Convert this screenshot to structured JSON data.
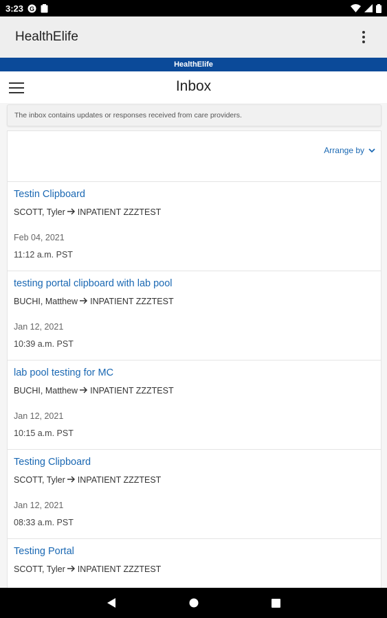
{
  "status_bar": {
    "time": "3:23",
    "icons": [
      "google-icon",
      "clipboard-icon",
      "wifi-icon",
      "signal-icon",
      "battery-icon"
    ]
  },
  "app_bar": {
    "title": "HealthElife",
    "overflow_icon": "more-vert-icon"
  },
  "brand_strip": {
    "label": "HealthElife",
    "color": "#0b4a99"
  },
  "page": {
    "title": "Inbox",
    "menu_icon": "hamburger-icon",
    "info_text": "The inbox contains updates or responses received from care providers."
  },
  "arrange": {
    "label": "Arrange by",
    "icon": "chevron-down-icon"
  },
  "messages": [
    {
      "title": "Testin Clipboard",
      "from": "SCOTT, Tyler",
      "to": "INPATIENT ZZZTEST",
      "date": "Feb 04, 2021",
      "time": "11:12 a.m. PST"
    },
    {
      "title": "testing portal clipboard with lab pool",
      "from": "BUCHI, Matthew",
      "to": "INPATIENT ZZZTEST",
      "date": "Jan 12, 2021",
      "time": "10:39 a.m. PST"
    },
    {
      "title": "lab pool testing for MC",
      "from": "BUCHI, Matthew",
      "to": "INPATIENT ZZZTEST",
      "date": "Jan 12, 2021",
      "time": "10:15 a.m. PST"
    },
    {
      "title": "Testing Clipboard",
      "from": "SCOTT, Tyler",
      "to": "INPATIENT ZZZTEST",
      "date": "Jan 12, 2021",
      "time": "08:33 a.m. PST"
    },
    {
      "title": "Testing Portal",
      "from": "SCOTT, Tyler",
      "to": "INPATIENT ZZZTEST",
      "date": "",
      "time": ""
    }
  ],
  "nav_bar": {
    "icons": [
      "back-icon",
      "home-icon",
      "recents-icon"
    ]
  },
  "colors": {
    "accent": "#1a68b3",
    "brand": "#0b4a99"
  }
}
